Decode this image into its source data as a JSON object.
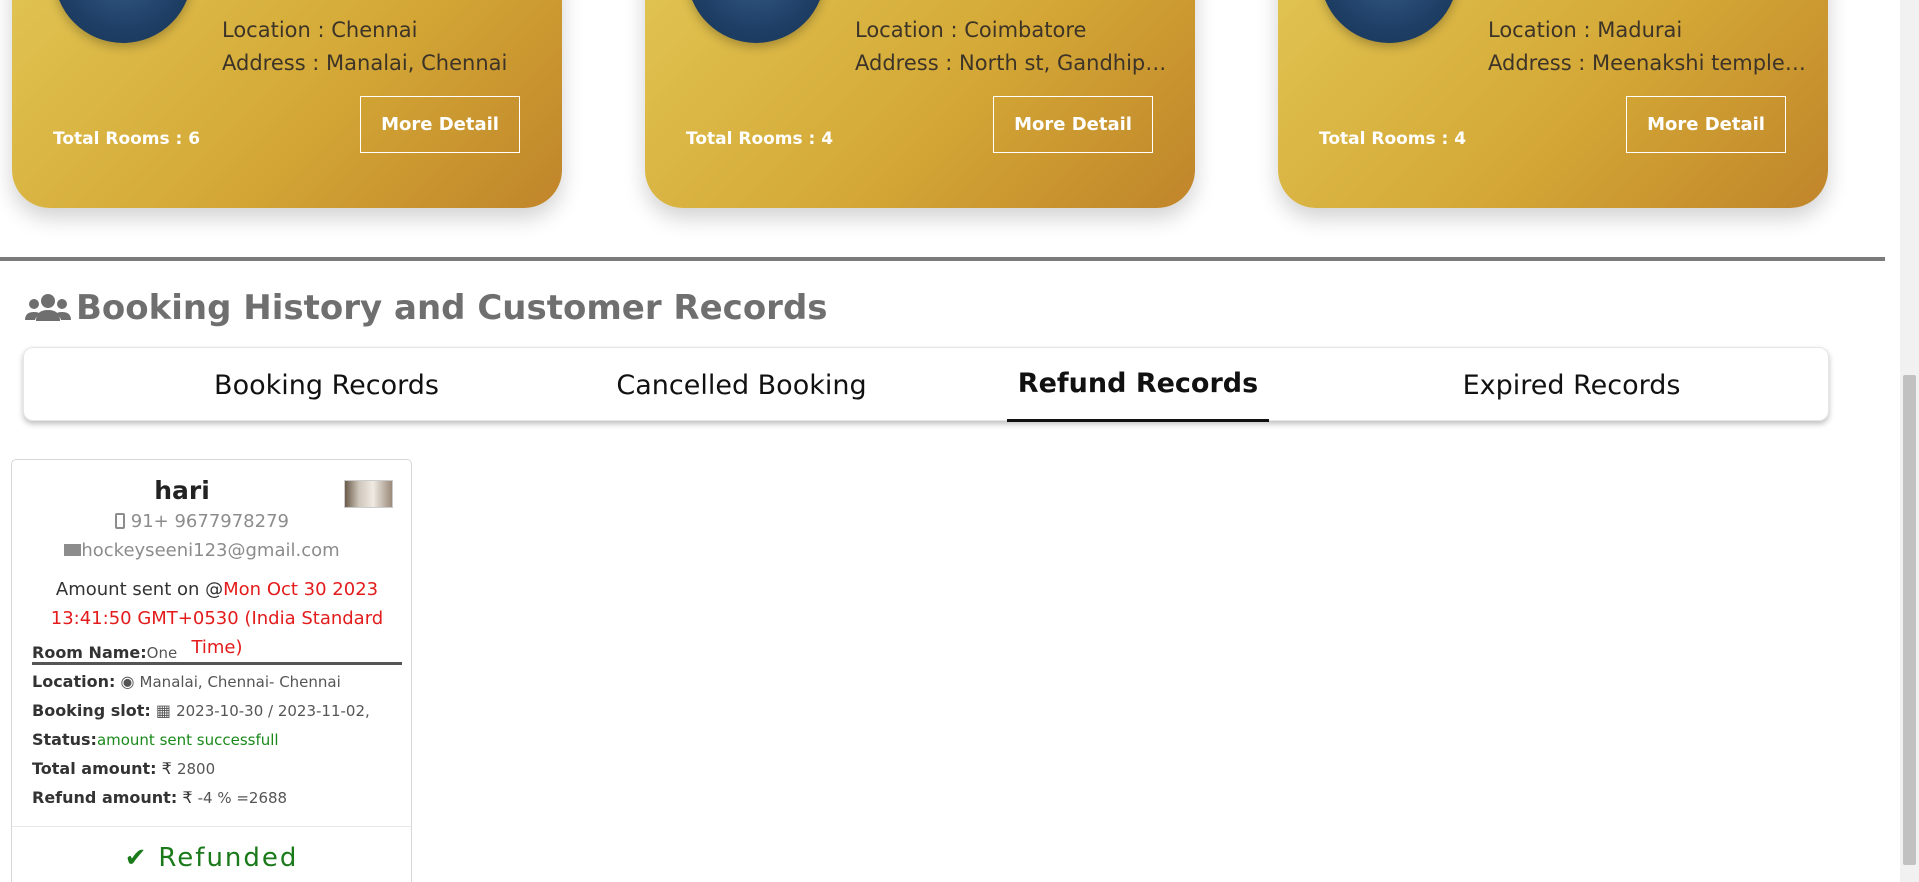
{
  "hotels": [
    {
      "location": "Location : Chennai",
      "address": "Address : Manalai, Chennai",
      "rooms": "Total Rooms : 6",
      "button": "More Detail"
    },
    {
      "location": "Location : Coimbatore",
      "address": "Address : North st, Gandhipura...",
      "rooms": "Total Rooms : 4",
      "button": "More Detail"
    },
    {
      "location": "Location : Madurai",
      "address": "Address : Meenakshi temple, M...",
      "rooms": "Total Rooms : 4",
      "button": "More Detail"
    }
  ],
  "section": {
    "title": "Booking History and Customer Records",
    "icon": "users-icon"
  },
  "tabs": [
    {
      "label": "Booking Records"
    },
    {
      "label": "Cancelled Booking"
    },
    {
      "label": "Refund Records"
    },
    {
      "label": "Expired Records"
    }
  ],
  "active_tab": "Refund Records",
  "record": {
    "name": "hari",
    "phone": "91+ 9677978279",
    "email": "hockeyseeni123@gmail.com",
    "sent_prefix": "Amount sent on @",
    "sent_date": "Mon Oct 30 2023 13:41:50 GMT+0530 (India Standard Time)",
    "room_label": "Room Name:",
    "room_value": "One",
    "location_label": "Location:",
    "location_value": "Manalai, Chennai- Chennai",
    "slot_label": "Booking slot:",
    "slot_value": "2023-10-30 / 2023-11-02,",
    "status_label": "Status:",
    "status_value": "amount sent successfull",
    "total_label": "Total amount:",
    "total_value": "2800",
    "refund_label": "Refund amount:",
    "refund_value": "-4 % =2688",
    "refunded_label": "Refunded"
  },
  "colors": {
    "card_gold_start": "#e1c553",
    "card_gold_end": "#c0852a",
    "date_red": "#e31b1b",
    "status_green": "#1a8a1a",
    "title_gray": "#6f6f6f"
  }
}
